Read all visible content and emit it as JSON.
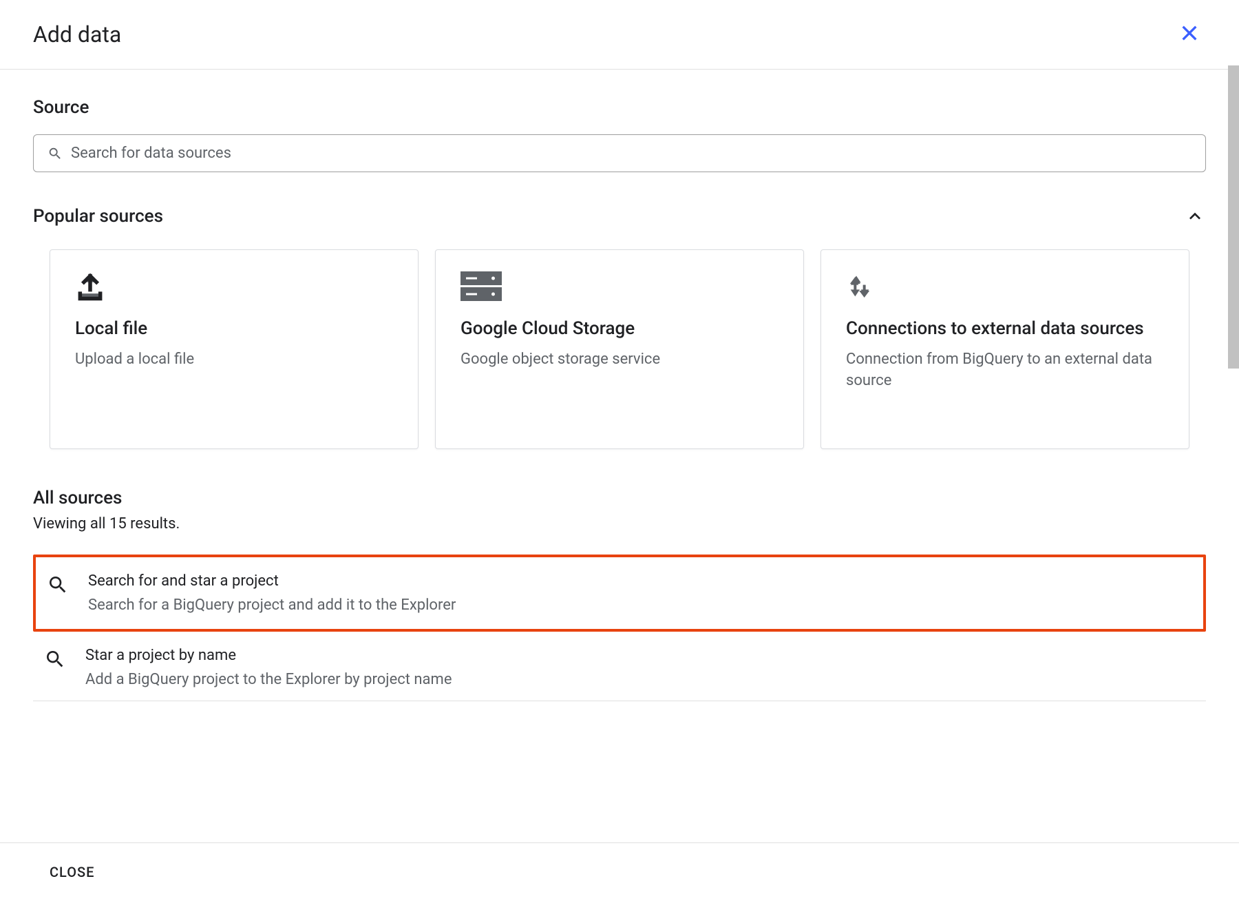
{
  "header": {
    "title": "Add data"
  },
  "source": {
    "label": "Source",
    "search_placeholder": "Search for data sources"
  },
  "popular": {
    "heading": "Popular sources",
    "cards": [
      {
        "icon": "upload-icon",
        "title": "Local file",
        "subtitle": "Upload a local file"
      },
      {
        "icon": "storage-icon",
        "title": "Google Cloud Storage",
        "subtitle": "Google object storage service"
      },
      {
        "icon": "connection-icon",
        "title": "Connections to external data sources",
        "subtitle": "Connection from BigQuery to an external data source"
      }
    ]
  },
  "all_sources": {
    "heading": "All sources",
    "results_text": "Viewing all 15 results.",
    "items": [
      {
        "icon": "search-icon",
        "title": "Search for and star a project",
        "subtitle": "Search for a BigQuery project and add it to the Explorer",
        "highlighted": true
      },
      {
        "icon": "search-icon",
        "title": "Star a project by name",
        "subtitle": "Add a BigQuery project to the Explorer by project name",
        "highlighted": false
      }
    ]
  },
  "footer": {
    "close_label": "CLOSE"
  }
}
